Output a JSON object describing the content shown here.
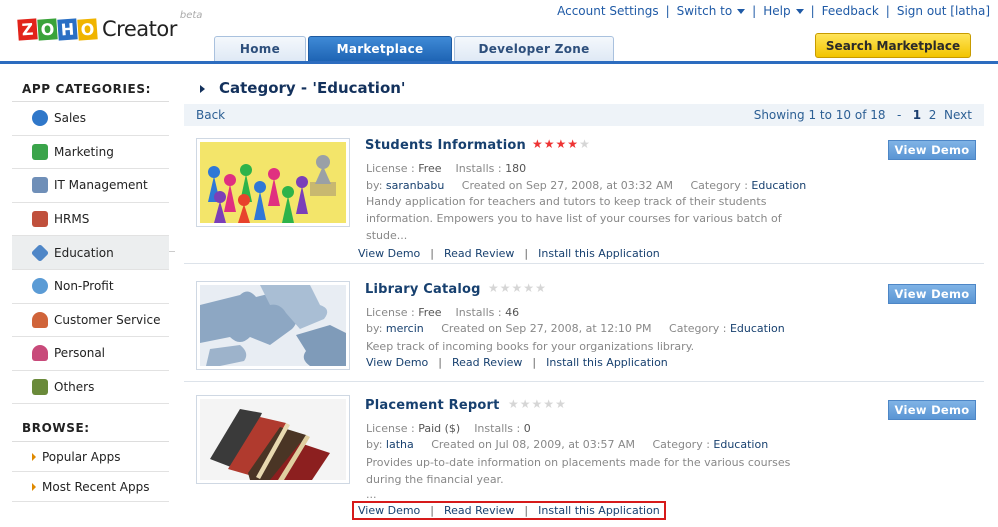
{
  "header": {
    "logo": {
      "letters": [
        "Z",
        "O",
        "H",
        "O"
      ],
      "product": "Creator",
      "beta": "beta"
    },
    "top_links": {
      "account_settings": "Account Settings",
      "switch_to": "Switch to",
      "help": "Help",
      "feedback": "Feedback",
      "sign_out": "Sign out [latha]"
    },
    "tabs": [
      {
        "label": "Home",
        "active": false
      },
      {
        "label": "Marketplace",
        "active": true
      },
      {
        "label": "Developer Zone",
        "active": false
      }
    ],
    "search_button": "Search Marketplace"
  },
  "sidebar": {
    "categories_title": "APP CATEGORIES:",
    "categories": [
      {
        "label": "Sales",
        "icon": "sales-icon",
        "color": "#2f77c9"
      },
      {
        "label": "Marketing",
        "icon": "marketing-icon",
        "color": "#3aa44a"
      },
      {
        "label": "IT Management",
        "icon": "it-management-icon",
        "color": "#6f8fb8"
      },
      {
        "label": "HRMS",
        "icon": "hrms-icon",
        "color": "#c0503c"
      },
      {
        "label": "Education",
        "icon": "education-icon",
        "color": "#4f86c7",
        "selected": true
      },
      {
        "label": "Non-Profit",
        "icon": "non-profit-icon",
        "color": "#5b9bd5"
      },
      {
        "label": "Customer Service",
        "icon": "customer-service-icon",
        "color": "#d0643a"
      },
      {
        "label": "Personal",
        "icon": "personal-icon",
        "color": "#c84a7a"
      },
      {
        "label": "Others",
        "icon": "others-icon",
        "color": "#6a8a3a"
      }
    ],
    "browse_title": "BROWSE:",
    "browse": [
      "Popular Apps",
      "Most Recent Apps"
    ]
  },
  "main": {
    "heading": "Category - 'Education'",
    "back": "Back",
    "pager": {
      "showing": "Showing 1 to 10 of 18",
      "dash": "-",
      "current": "1",
      "page2": "2",
      "next": "Next"
    },
    "labels": {
      "license": "License :",
      "installs": "Installs :",
      "by": "by:",
      "category": "Category :",
      "view_demo_btn": "View Demo",
      "view_demo": "View Demo",
      "read_review": "Read Review",
      "install": "Install this Application"
    },
    "apps": [
      {
        "title": "Students Information",
        "rating": 4,
        "license": "Free",
        "installs": "180",
        "author": "saranbabu",
        "created": "Created on Sep 27, 2008, at 03:32 AM",
        "category": "Education",
        "description": "Handy application for teachers and tutors to keep track of their students information. Empowers you to have list of your courses for various batch of stude...",
        "image": "colored-pawns-image"
      },
      {
        "title": "Library Catalog",
        "rating": 0,
        "license": "Free",
        "installs": "46",
        "author": "mercin",
        "created": "Created on Sep 27, 2008, at 12:10 PM",
        "category": "Education",
        "description": "Keep track of incoming books for your organizations library.",
        "image": "puzzle-pieces-image"
      },
      {
        "title": "Placement Report",
        "rating": 0,
        "license": "Paid ($)",
        "installs": "0",
        "author": "latha",
        "created": "Created on Jul 08, 2009, at 03:57 AM",
        "category": "Education",
        "description": "Provides up-to-date information on placements made for the various courses during the financial year.",
        "ellipsis": "...",
        "image": "stacked-books-image"
      }
    ]
  },
  "colors": {
    "brand_blue": "#2c6cbf",
    "search_yellow": "#f2c400",
    "highlight_red": "#d61a1a",
    "star_red": "#e33333"
  }
}
